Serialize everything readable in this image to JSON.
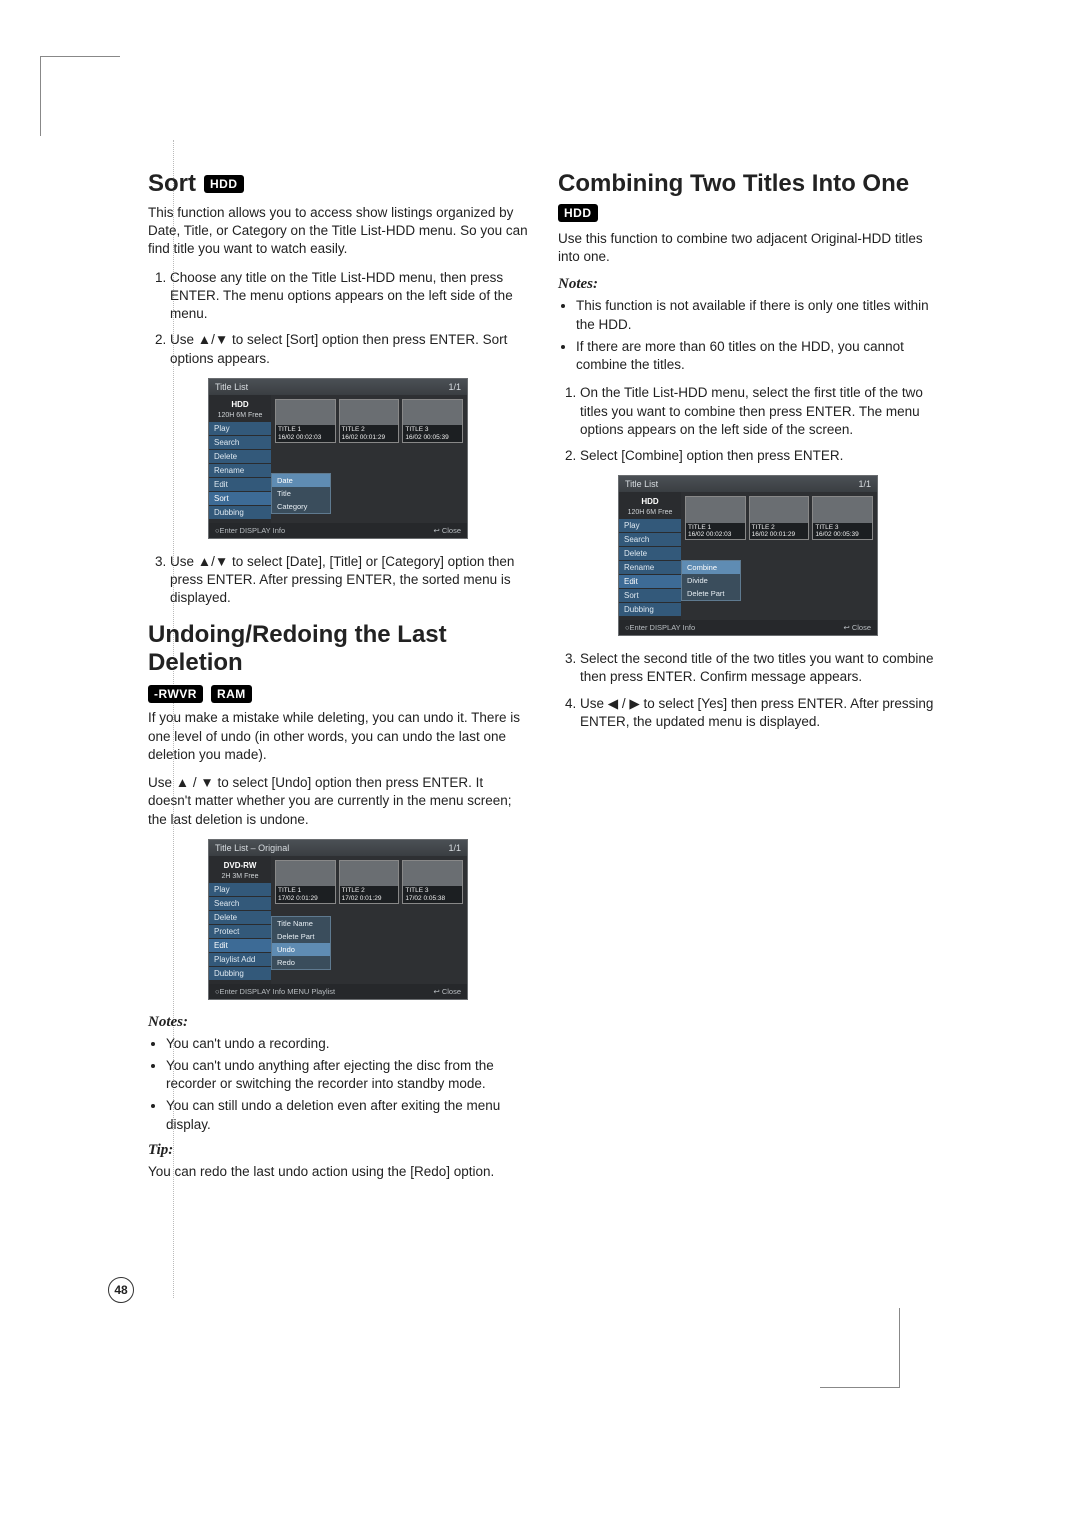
{
  "page_number": "48",
  "left": {
    "sort": {
      "heading": "Sort",
      "badge": "HDD",
      "intro": "This function allows you to access show listings organized by Date, Title, or Category on the Title List-HDD menu. So you can find title you want to watch easily.",
      "steps": [
        "Choose any title on the Title List-HDD menu, then press ENTER.\nThe menu options appears on the left side of the menu.",
        "Use ▲/▼ to select [Sort] option then press ENTER. Sort options appears.",
        "Use ▲/▼ to select [Date], [Title] or [Category] option then press ENTER.\nAfter pressing ENTER, the sorted menu is displayed."
      ],
      "osd": {
        "title": "Title List",
        "page": "1/1",
        "disc": "HDD",
        "free": "120H 6M Free",
        "menu": [
          "Play",
          "Search",
          "Delete",
          "Rename",
          "Edit",
          "Sort",
          "Dubbing"
        ],
        "submenu": [
          "Date",
          "Title",
          "Category"
        ],
        "thumbs": [
          {
            "t": "TITLE 1",
            "d": "16/02",
            "len": "00:02:03"
          },
          {
            "t": "TITLE 2",
            "d": "16/02",
            "len": "00:01:29"
          },
          {
            "t": "TITLE 3",
            "d": "16/02",
            "len": "00:05:39"
          }
        ],
        "footer_left": "○Enter  DISPLAY Info",
        "footer_right": "↩ Close"
      }
    },
    "undo": {
      "heading": "Undoing/Redoing the Last Deletion",
      "badges": [
        "-RWVR",
        "RAM"
      ],
      "para1": "If you make a mistake while deleting, you can undo it. There is one level of undo (in other words, you can undo the last one deletion you made).",
      "para2": "Use ▲ / ▼ to select [Undo] option then press ENTER. It doesn't matter whether you are currently in the menu screen; the last deletion is undone.",
      "osd": {
        "title": "Title List – Original",
        "page": "1/1",
        "disc": "DVD-RW",
        "free": "2H 3M Free",
        "menu": [
          "Play",
          "Search",
          "Delete",
          "Protect",
          "Edit",
          "Playlist Add",
          "Dubbing"
        ],
        "submenu": [
          "Title Name",
          "Delete Part",
          "Undo",
          "Redo"
        ],
        "thumbs": [
          {
            "t": "TITLE 1",
            "d": "17/02",
            "len": "0:01:29"
          },
          {
            "t": "TITLE 2",
            "d": "17/02",
            "len": "0:01:29"
          },
          {
            "t": "TITLE 3",
            "d": "17/02",
            "len": "0:05:38"
          }
        ],
        "footer_left": "○Enter  DISPLAY Info  MENU Playlist",
        "footer_right": "↩ Close"
      },
      "notes_head": "Notes:",
      "notes": [
        "You can't undo a recording.",
        "You can't undo anything after ejecting the disc from the recorder or switching the recorder into standby mode.",
        "You can still undo a deletion even after exiting the menu display."
      ],
      "tip_head": "Tip:",
      "tip": "You can redo the last undo action using the [Redo] option."
    }
  },
  "right": {
    "combine": {
      "heading": "Combining Two Titles Into One",
      "badge": "HDD",
      "intro": "Use this function to combine two adjacent Original-HDD titles into one.",
      "notes_head": "Notes:",
      "notes": [
        "This function is not available if there is only one titles within the HDD.",
        "If there are more than 60 titles on the HDD, you cannot combine the titles."
      ],
      "steps_a": [
        "On the Title List-HDD menu, select the first title of the two titles you want to combine then press ENTER.\nThe menu options appears on the left side of the screen.",
        "Select [Combine] option then press ENTER."
      ],
      "osd": {
        "title": "Title List",
        "page": "1/1",
        "disc": "HDD",
        "free": "120H 6M Free",
        "menu": [
          "Play",
          "Search",
          "Delete",
          "Rename",
          "Edit",
          "Sort",
          "Dubbing"
        ],
        "submenu": [
          "Combine",
          "Divide",
          "Delete Part"
        ],
        "thumbs": [
          {
            "t": "TITLE 1",
            "d": "16/02",
            "len": "00:02:03"
          },
          {
            "t": "TITLE 2",
            "d": "16/02",
            "len": "00:01:29"
          },
          {
            "t": "TITLE 3",
            "d": "16/02",
            "len": "00:05:39"
          }
        ],
        "footer_left": "○Enter  DISPLAY Info",
        "footer_right": "↩ Close"
      },
      "steps_b": [
        "Select the second title of the two titles you want to combine then press ENTER.\nConfirm message appears.",
        "Use ◀ / ▶ to select [Yes] then press ENTER.\nAfter pressing ENTER, the updated menu is displayed."
      ]
    }
  }
}
